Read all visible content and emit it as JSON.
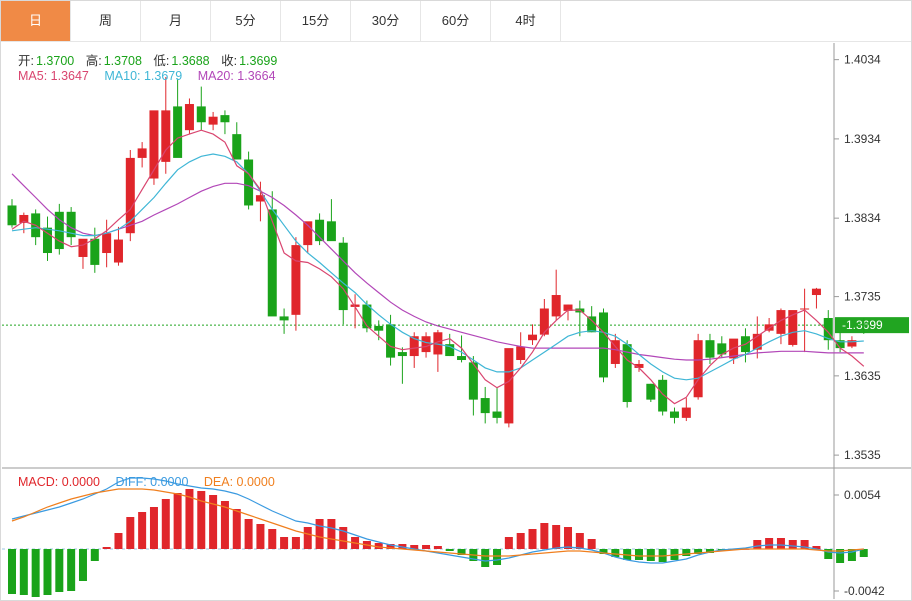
{
  "tabs": [
    "日",
    "周",
    "月",
    "5分",
    "15分",
    "30分",
    "60分",
    "4时"
  ],
  "active_tab": 0,
  "ohlc_info": {
    "open_label": "开:",
    "open": "1.3700",
    "high_label": "高:",
    "high": "1.3708",
    "low_label": "低:",
    "low": "1.3688",
    "close_label": "收:",
    "close": "1.3699"
  },
  "ma_info": {
    "ma5": "MA5: 1.3647",
    "ma10": "MA10: 1.3679",
    "ma20": "MA20: 1.3664"
  },
  "macd_info": {
    "macd": "MACD: 0.0000",
    "diff": "DIFF: 0.0000",
    "dea": "DEA: 0.0000"
  },
  "current_price_label": "1.3699",
  "colors": {
    "up": "#e0262b",
    "down": "#1aa31a",
    "ma5": "#d9456f",
    "ma10": "#3fb6d6",
    "ma20": "#b247b8",
    "diff": "#3a9ae0",
    "dea": "#f07f1e",
    "price_tag": "#21a521",
    "tab_active": "#f08a46"
  },
  "chart_data": [
    {
      "type": "candlestick",
      "title": "",
      "ylim": [
        1.352,
        1.4055
      ],
      "yticks": [
        "1.4034",
        "1.3934",
        "1.3834",
        "1.3735",
        "1.3635",
        "1.3535"
      ],
      "current_price": 1.3699,
      "candles": [
        [
          1.385,
          1.3858,
          1.3822,
          1.3825
        ],
        [
          1.3828,
          1.3841,
          1.3815,
          1.3838
        ],
        [
          1.384,
          1.3845,
          1.38,
          1.381
        ],
        [
          1.3822,
          1.3836,
          1.378,
          1.379
        ],
        [
          1.3842,
          1.3852,
          1.3788,
          1.3795
        ],
        [
          1.3842,
          1.3848,
          1.38,
          1.381
        ],
        [
          1.3785,
          1.3806,
          1.377,
          1.3808
        ],
        [
          1.3808,
          1.3822,
          1.3765,
          1.3775
        ],
        [
          1.379,
          1.3832,
          1.3772,
          1.3815
        ],
        [
          1.3778,
          1.3823,
          1.3774,
          1.3807
        ],
        [
          1.3815,
          1.392,
          1.3805,
          1.391
        ],
        [
          1.391,
          1.393,
          1.3898,
          1.3922
        ],
        [
          1.3884,
          1.3938,
          1.3876,
          1.397
        ],
        [
          1.3905,
          1.4012,
          1.389,
          1.397
        ],
        [
          1.3975,
          1.401,
          1.3952,
          1.391
        ],
        [
          1.3945,
          1.3985,
          1.394,
          1.3978
        ],
        [
          1.3975,
          1.4,
          1.3945,
          1.3955
        ],
        [
          1.3952,
          1.3968,
          1.3945,
          1.3962
        ],
        [
          1.3964,
          1.397,
          1.394,
          1.3955
        ],
        [
          1.394,
          1.3955,
          1.3908,
          1.3908
        ],
        [
          1.3908,
          1.3918,
          1.3845,
          1.385
        ],
        [
          1.3855,
          1.388,
          1.383,
          1.3863
        ],
        [
          1.3845,
          1.3868,
          1.381,
          1.371
        ],
        [
          1.371,
          1.372,
          1.3688,
          1.3705
        ],
        [
          1.3712,
          1.381,
          1.3692,
          1.38
        ],
        [
          1.38,
          1.382,
          1.379,
          1.383
        ],
        [
          1.3832,
          1.384,
          1.38,
          1.3805
        ],
        [
          1.383,
          1.3858,
          1.382,
          1.3805
        ],
        [
          1.3803,
          1.381,
          1.37,
          1.3718
        ],
        [
          1.3722,
          1.3738,
          1.3695,
          1.3725
        ],
        [
          1.3725,
          1.373,
          1.369,
          1.3695
        ],
        [
          1.3698,
          1.3705,
          1.368,
          1.3692
        ],
        [
          1.37,
          1.3712,
          1.3648,
          1.3658
        ],
        [
          1.3665,
          1.3671,
          1.3625,
          1.366
        ],
        [
          1.366,
          1.369,
          1.3645,
          1.3685
        ],
        [
          1.3665,
          1.369,
          1.3658,
          1.3685
        ],
        [
          1.3662,
          1.3693,
          1.364,
          1.369
        ],
        [
          1.3675,
          1.3688,
          1.366,
          1.366
        ],
        [
          1.366,
          1.3686,
          1.3652,
          1.3655
        ],
        [
          1.3652,
          1.366,
          1.3585,
          1.3605
        ],
        [
          1.3607,
          1.3621,
          1.3575,
          1.3588
        ],
        [
          1.359,
          1.362,
          1.3575,
          1.3582
        ],
        [
          1.3575,
          1.366,
          1.357,
          1.367
        ],
        [
          1.3655,
          1.369,
          1.365,
          1.3672
        ],
        [
          1.368,
          1.37,
          1.3674,
          1.3687
        ],
        [
          1.3687,
          1.3732,
          1.3685,
          1.372
        ],
        [
          1.371,
          1.3769,
          1.3705,
          1.3737
        ],
        [
          1.3717,
          1.3725,
          1.3705,
          1.3725
        ],
        [
          1.372,
          1.373,
          1.3685,
          1.3715
        ],
        [
          1.371,
          1.3723,
          1.369,
          1.369
        ],
        [
          1.3715,
          1.372,
          1.3627,
          1.3633
        ],
        [
          1.365,
          1.3688,
          1.3645,
          1.368
        ],
        [
          1.3675,
          1.368,
          1.3595,
          1.3602
        ],
        [
          1.3645,
          1.3655,
          1.364,
          1.365
        ],
        [
          1.3625,
          1.3625,
          1.3602,
          1.3605
        ],
        [
          1.363,
          1.3636,
          1.3585,
          1.359
        ],
        [
          1.359,
          1.3595,
          1.3575,
          1.3582
        ],
        [
          1.3582,
          1.3607,
          1.3578,
          1.3595
        ],
        [
          1.3608,
          1.3688,
          1.3605,
          1.368
        ],
        [
          1.368,
          1.3688,
          1.365,
          1.3658
        ],
        [
          1.3676,
          1.3685,
          1.3658,
          1.3662
        ],
        [
          1.3657,
          1.368,
          1.365,
          1.3682
        ],
        [
          1.3685,
          1.3695,
          1.3652,
          1.3665
        ],
        [
          1.3668,
          1.371,
          1.3657,
          1.3688
        ],
        [
          1.3692,
          1.3708,
          1.369,
          1.37
        ],
        [
          1.3688,
          1.372,
          1.3675,
          1.3718
        ],
        [
          1.3674,
          1.371,
          1.3672,
          1.3718
        ],
        [
          1.372,
          1.3745,
          1.3665,
          1.372
        ],
        [
          1.3737,
          1.3746,
          1.372,
          1.3745
        ],
        [
          1.3708,
          1.3718,
          1.3668,
          1.368
        ],
        [
          1.368,
          1.369,
          1.3665,
          1.367
        ],
        [
          1.3672,
          1.3685,
          1.367,
          1.368
        ],
        [
          1.37,
          1.3708,
          1.3688,
          1.3699
        ]
      ],
      "ma5": [
        1.382,
        1.383,
        1.3825,
        1.3815,
        1.3805,
        1.3798,
        1.38,
        1.3808,
        1.3818,
        1.3832,
        1.3845,
        1.387,
        1.3895,
        1.392,
        1.3935,
        1.394,
        1.3945,
        1.394,
        1.393,
        1.39,
        1.389,
        1.387,
        1.383,
        1.379,
        1.378,
        1.3778,
        1.377,
        1.376,
        1.3745,
        1.3722,
        1.3698,
        1.3685,
        1.3672,
        1.3668,
        1.367,
        1.3672,
        1.3678,
        1.3682,
        1.367,
        1.365,
        1.363,
        1.362,
        1.3628,
        1.3645,
        1.3665,
        1.369,
        1.3705,
        1.3718,
        1.3718,
        1.3705,
        1.369,
        1.3672,
        1.3655,
        1.3645,
        1.363,
        1.3612,
        1.36,
        1.3608,
        1.363,
        1.3648,
        1.3662,
        1.367,
        1.3675,
        1.3685,
        1.3695,
        1.3705,
        1.3712,
        1.3718,
        1.3705,
        1.369,
        1.367,
        1.366,
        1.3647
      ],
      "ma10": [
        1.3818,
        1.382,
        1.3822,
        1.382,
        1.3818,
        1.3815,
        1.3812,
        1.3812,
        1.3815,
        1.382,
        1.383,
        1.3845,
        1.386,
        1.3878,
        1.3895,
        1.3905,
        1.3912,
        1.3915,
        1.3912,
        1.3905,
        1.389,
        1.3868,
        1.3845,
        1.3825,
        1.3805,
        1.379,
        1.3778,
        1.3765,
        1.3752,
        1.374,
        1.3725,
        1.3712,
        1.37,
        1.369,
        1.3682,
        1.3677,
        1.3675,
        1.3672,
        1.3665,
        1.3655,
        1.3645,
        1.364,
        1.364,
        1.3645,
        1.3655,
        1.3665,
        1.3675,
        1.3685,
        1.369,
        1.3692,
        1.369,
        1.3685,
        1.3675,
        1.3662,
        1.365,
        1.364,
        1.3632,
        1.363,
        1.3632,
        1.364,
        1.3648,
        1.3656,
        1.3662,
        1.367,
        1.3678,
        1.3685,
        1.369,
        1.3692,
        1.3688,
        1.3682,
        1.3678,
        1.3678,
        1.3679
      ],
      "ma20": [
        1.389,
        1.3875,
        1.386,
        1.3845,
        1.3832,
        1.3822,
        1.3815,
        1.3812,
        1.3815,
        1.382,
        1.3825,
        1.383,
        1.3838,
        1.3845,
        1.3852,
        1.386,
        1.3868,
        1.3874,
        1.3878,
        1.3878,
        1.3875,
        1.3868,
        1.386,
        1.385,
        1.3838,
        1.3825,
        1.381,
        1.3795,
        1.378,
        1.3765,
        1.3752,
        1.374,
        1.3728,
        1.3718,
        1.371,
        1.3703,
        1.3698,
        1.3694,
        1.369,
        1.3686,
        1.3682,
        1.3678,
        1.3675,
        1.3672,
        1.367,
        1.367,
        1.367,
        1.367,
        1.367,
        1.367,
        1.367,
        1.3668,
        1.3665,
        1.3662,
        1.366,
        1.3658,
        1.3656,
        1.3655,
        1.3655,
        1.3656,
        1.3658,
        1.366,
        1.3662,
        1.3664,
        1.3665,
        1.3666,
        1.3666,
        1.3666,
        1.3665,
        1.3664,
        1.3664,
        1.3664,
        1.3664
      ]
    },
    {
      "type": "bar",
      "title": "",
      "ylim": [
        -0.005,
        0.008
      ],
      "yticks": [
        "0.0054",
        "-0.0042"
      ],
      "macd": [
        -0.0045,
        -0.0046,
        -0.0048,
        -0.0046,
        -0.0043,
        -0.0042,
        -0.0032,
        -0.0012,
        0.0002,
        0.0016,
        0.0032,
        0.0037,
        0.0042,
        0.005,
        0.0056,
        0.006,
        0.0058,
        0.0054,
        0.0048,
        0.004,
        0.003,
        0.0025,
        0.002,
        0.0012,
        0.0012,
        0.0022,
        0.003,
        0.003,
        0.0022,
        0.0012,
        0.0008,
        0.0006,
        0.0005,
        0.0005,
        0.0004,
        0.0004,
        0.0003,
        -0.0002,
        -0.0006,
        -0.0012,
        -0.0018,
        -0.0016,
        0.0012,
        0.0016,
        0.002,
        0.0026,
        0.0024,
        0.0022,
        0.0016,
        0.001,
        -0.0005,
        -0.0008,
        -0.0011,
        -0.0011,
        -0.0012,
        -0.0013,
        -0.0011,
        -0.0007,
        -0.0005,
        -0.0004,
        -0.0002,
        -0.0001,
        0.0,
        0.0009,
        0.0011,
        0.0011,
        0.0009,
        0.0009,
        0.0003,
        -0.001,
        -0.0014,
        -0.0012,
        -0.0008
      ],
      "diff": [
        0.003,
        0.0033,
        0.0036,
        0.0039,
        0.0042,
        0.0046,
        0.005,
        0.0055,
        0.006,
        0.0067,
        0.0071,
        0.0071,
        0.007,
        0.0068,
        0.0065,
        0.0063,
        0.0061,
        0.006,
        0.0058,
        0.0055,
        0.005,
        0.0044,
        0.0038,
        0.0033,
        0.0028,
        0.0026,
        0.0023,
        0.0021,
        0.0018,
        0.0014,
        0.001,
        0.0007,
        0.0004,
        0.0002,
        0.0,
        -0.0002,
        -0.0004,
        -0.0006,
        -0.0008,
        -0.001,
        -0.0012,
        -0.0011,
        -0.0009,
        -0.0006,
        -0.0003,
        -0.0001,
        0.0001,
        0.0002,
        0.0001,
        -0.0001,
        -0.0004,
        -0.0008,
        -0.0011,
        -0.0013,
        -0.0014,
        -0.0014,
        -0.0012,
        -0.001,
        -0.0006,
        -0.0003,
        -0.0001,
        0.0,
        0.0001,
        0.0003,
        0.0004,
        0.0004,
        0.0003,
        0.0002,
        0.0,
        -0.0003,
        -0.0004,
        -0.0003,
        0.0
      ],
      "dea": [
        0.0028,
        0.0032,
        0.0037,
        0.0042,
        0.0046,
        0.005,
        0.0053,
        0.0056,
        0.0058,
        0.006,
        0.006,
        0.006,
        0.0059,
        0.0057,
        0.0055,
        0.0052,
        0.0048,
        0.0045,
        0.0042,
        0.0038,
        0.0034,
        0.003,
        0.0026,
        0.0022,
        0.0018,
        0.0015,
        0.0012,
        0.001,
        0.0008,
        0.0006,
        0.0004,
        0.0002,
        0.0001,
        0.0,
        -0.0001,
        -0.0002,
        -0.0003,
        -0.0004,
        -0.0005,
        -0.0006,
        -0.0007,
        -0.0007,
        -0.0007,
        -0.0006,
        -0.0005,
        -0.0004,
        -0.0003,
        -0.0002,
        -0.0002,
        -0.0003,
        -0.0004,
        -0.0005,
        -0.0006,
        -0.0007,
        -0.0007,
        -0.0007,
        -0.0006,
        -0.0005,
        -0.0004,
        -0.0003,
        -0.0002,
        -0.0001,
        0.0,
        0.0,
        0.0,
        0.0,
        0.0,
        0.0,
        -0.0001,
        -0.0002,
        -0.0002,
        -0.0001,
        0.0
      ]
    }
  ]
}
